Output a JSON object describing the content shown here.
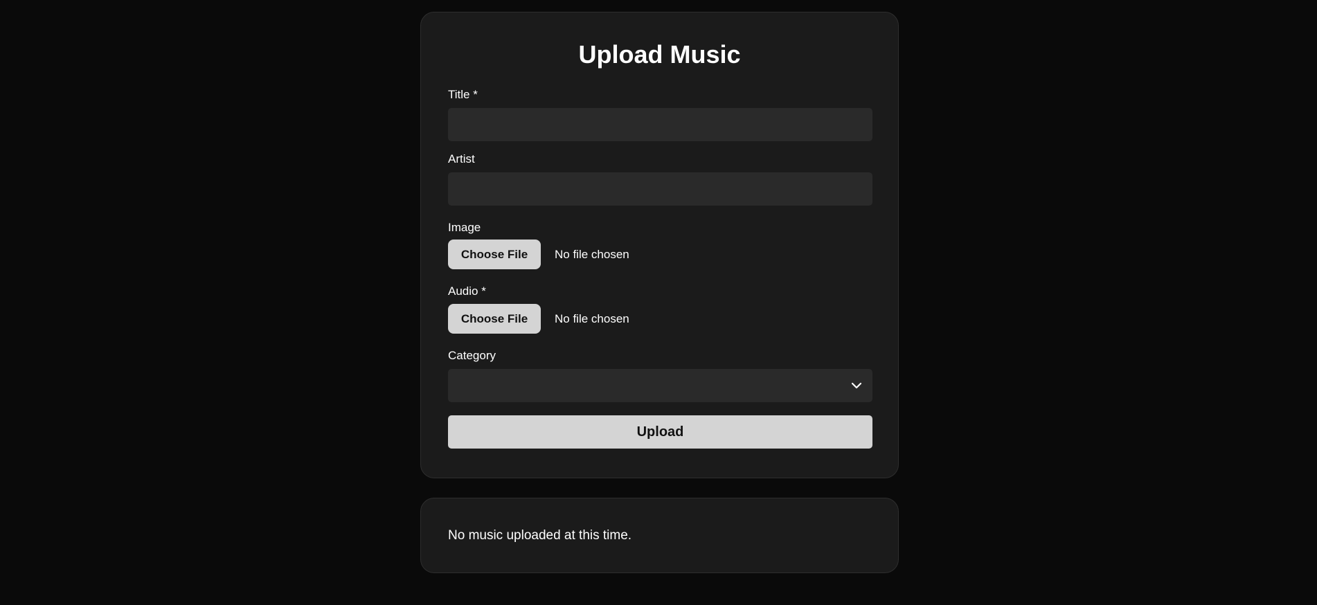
{
  "form": {
    "heading": "Upload Music",
    "title_label": "Title *",
    "title_value": "",
    "artist_label": "Artist",
    "artist_value": "",
    "image_label": "Image",
    "image_button": "Choose File",
    "image_status": "No file chosen",
    "audio_label": "Audio *",
    "audio_button": "Choose File",
    "audio_status": "No file chosen",
    "category_label": "Category",
    "category_value": "",
    "submit_label": "Upload"
  },
  "list": {
    "empty_message": "No music uploaded at this time."
  },
  "icons": {
    "category_dropdown": "chevron-down-icon"
  },
  "colors": {
    "background": "#0a0a0a",
    "card": "#1b1b1b",
    "input": "#2a2a2a",
    "button": "#d4d4d4"
  }
}
